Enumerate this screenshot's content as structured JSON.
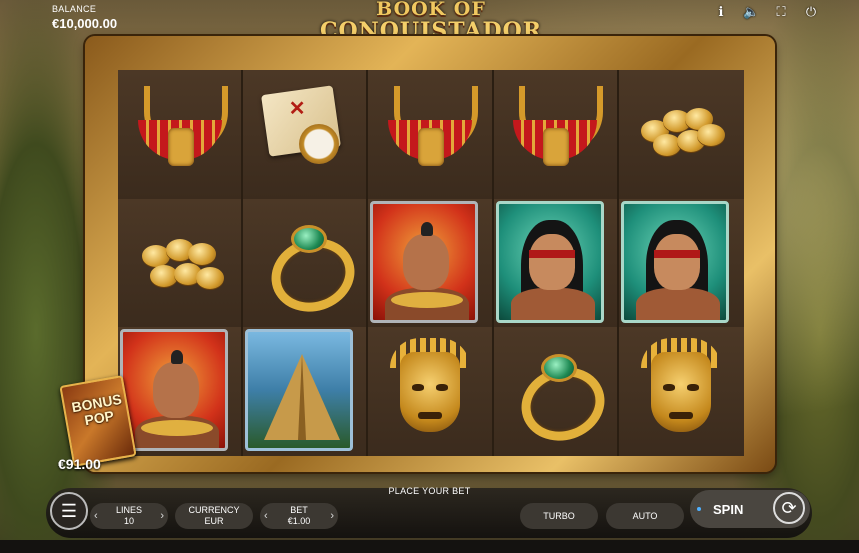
{
  "game": {
    "title_line1": "BOOK OF",
    "title_line2": "CONQUISTADOR"
  },
  "balance": {
    "label": "BALANCE",
    "value": "€10,000.00"
  },
  "top_icons": [
    "info-icon",
    "sound-icon",
    "fullscreen-icon",
    "power-icon"
  ],
  "reels": [
    [
      "necklace",
      "map",
      "necklace",
      "necklace",
      "coins"
    ],
    [
      "coins",
      "ring",
      "warrior-card",
      "woman-card",
      "woman-card"
    ],
    [
      "warrior-card",
      "pyramid-card",
      "mask",
      "ring",
      "mask"
    ]
  ],
  "bonus": {
    "title_line1": "BONUS",
    "title_line2": "POP",
    "amount": "€91.00"
  },
  "controls": {
    "place_bet": "PLACE YOUR BET",
    "lines_label": "LINES",
    "lines_value": "10",
    "currency_label": "CURRENCY",
    "currency_value": "EUR",
    "bet_label": "BET",
    "bet_value": "€1.00",
    "turbo_label": "TURBO",
    "auto_label": "AUTO",
    "spin_label": "SPIN"
  },
  "colors": {
    "gold": "#e3b457",
    "panel": "#3c3832",
    "accent_dot": "#4fb0ff"
  }
}
